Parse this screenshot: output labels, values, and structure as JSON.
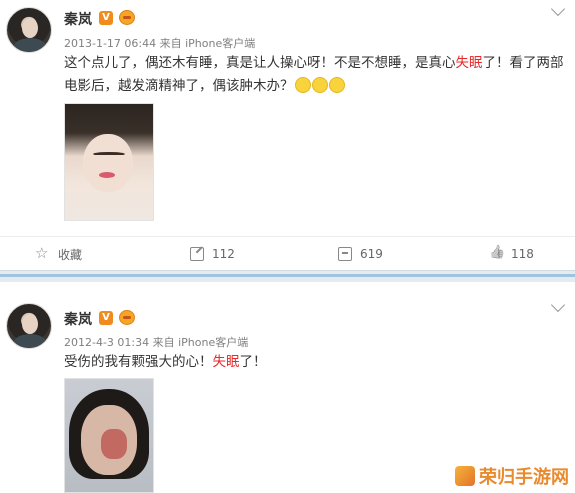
{
  "posts": [
    {
      "user": "秦岚",
      "meta": "2013-1-17 06:44 来自 iPhone客户端",
      "text_parts": [
        "这个点儿了，偶还木有睡，真是让人操心呀！不是不想睡，是真心",
        "失眠",
        "了！看了两部电影后，越发滴精神了，偶该肿木办？"
      ],
      "emoji_count": 3,
      "actions": {
        "favorite": "收藏",
        "repost": "112",
        "comments": "619",
        "likes": "118"
      }
    },
    {
      "user": "秦岚",
      "meta": "2012-4-3 01:34 来自 iPhone客户端",
      "text_parts": [
        "受伤的我有颗强大的心！",
        "失眠",
        "了！"
      ]
    }
  ],
  "verified_badge": "V",
  "watermark": "荣归手游网",
  "colors": {
    "highlight": "#e8282b",
    "badge": "#f08c1d",
    "divider": "#9fc4df"
  }
}
